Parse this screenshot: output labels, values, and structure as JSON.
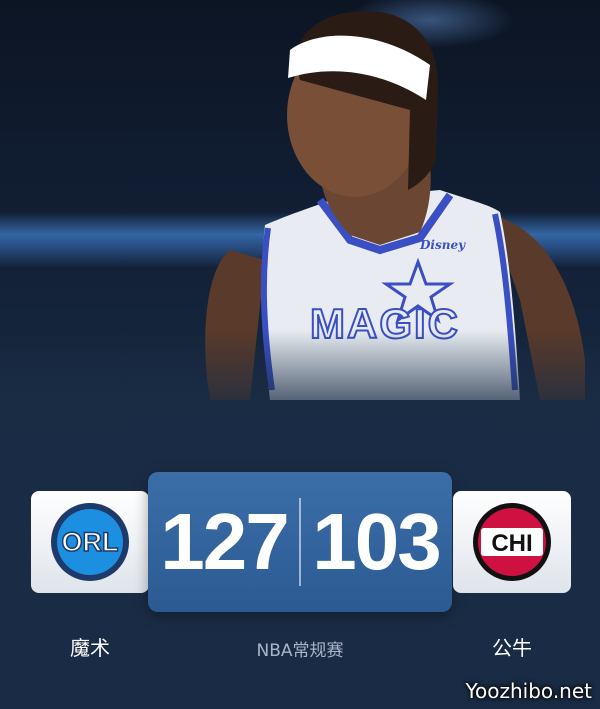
{
  "home_team": {
    "abbr": "ORL",
    "name": "魔术",
    "score": "127",
    "logo_color": "#1d8fe0"
  },
  "away_team": {
    "abbr": "CHI",
    "name": "公牛",
    "score": "103",
    "logo_color": "#ce1141"
  },
  "game_type": "NBA常规赛",
  "jersey": {
    "wordmark": "MAGIC",
    "sponsor": "Disney"
  },
  "watermark": "Yoozhibo.net",
  "colors": {
    "background": "#1a2c45",
    "scoreboard": "#2c5a93",
    "band": "#3c8ce6"
  }
}
